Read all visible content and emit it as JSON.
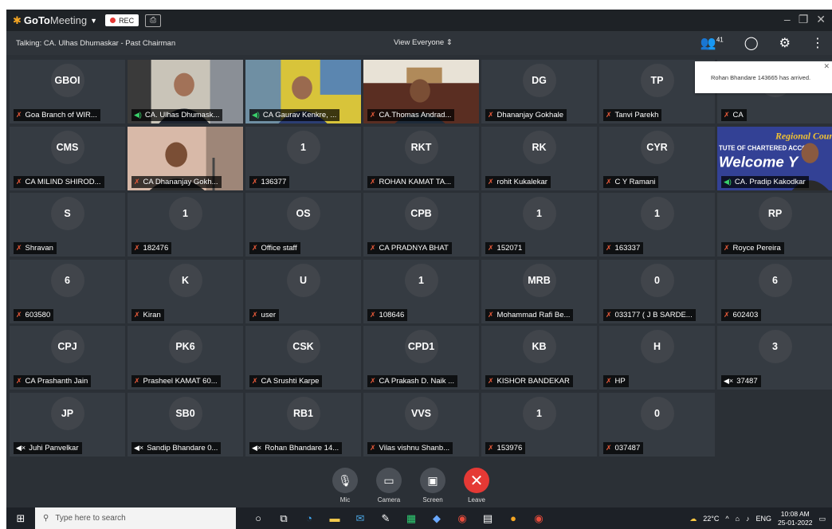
{
  "app": {
    "brand_go": "GoTo",
    "brand_meeting": "Meeting",
    "rec_label": "REC"
  },
  "subbar": {
    "talking": "Talking: CA. Ulhas Dhumaskar - Past Chairman",
    "view": "View Everyone",
    "attendee_count": "41"
  },
  "toast": {
    "message": "Rohan Bhandare 143665 has arrived."
  },
  "tiles": [
    {
      "initials": "GBOI",
      "label": "Goa Branch of WIR...",
      "icon": "muted"
    },
    {
      "initials": "",
      "label": "CA. Ulhas Dhumask...",
      "icon": "talk",
      "video": "v1"
    },
    {
      "initials": "",
      "label": "CA Gaurav Kenkre, ...",
      "icon": "talk",
      "video": "v2"
    },
    {
      "initials": "",
      "label": "CA.Thomas Andrad...",
      "icon": "muted",
      "video": "v3"
    },
    {
      "initials": "DG",
      "label": "Dhananjay Gokhale",
      "icon": "muted"
    },
    {
      "initials": "TP",
      "label": "Tanvi Parekh",
      "icon": "muted"
    },
    {
      "initials": "C",
      "label": "CA",
      "icon": "muted"
    },
    {
      "initials": "CMS",
      "label": "CA MILIND SHIROD...",
      "icon": "muted"
    },
    {
      "initials": "",
      "label": "CA Dhananjay Gokh...",
      "icon": "muted",
      "video": "v4"
    },
    {
      "initials": "1",
      "label": "136377",
      "icon": "muted"
    },
    {
      "initials": "RKT",
      "label": "ROHAN KAMAT TA...",
      "icon": "muted"
    },
    {
      "initials": "RK",
      "label": "rohit Kukalekar",
      "icon": "muted"
    },
    {
      "initials": "CYR",
      "label": "C Y Ramani",
      "icon": "muted"
    },
    {
      "initials": "",
      "label": "CA. Pradip Kakodkar",
      "icon": "talk",
      "video": "v5"
    },
    {
      "initials": "S",
      "label": "Shravan",
      "icon": "muted"
    },
    {
      "initials": "1",
      "label": "182476",
      "icon": "muted"
    },
    {
      "initials": "OS",
      "label": "Office staff",
      "icon": "muted"
    },
    {
      "initials": "CPB",
      "label": "CA PRADNYA BHAT",
      "icon": "muted"
    },
    {
      "initials": "1",
      "label": "152071",
      "icon": "muted"
    },
    {
      "initials": "1",
      "label": "163337",
      "icon": "muted"
    },
    {
      "initials": "RP",
      "label": "Royce Pereira",
      "icon": "muted"
    },
    {
      "initials": "6",
      "label": "603580",
      "icon": "muted"
    },
    {
      "initials": "K",
      "label": "Kiran",
      "icon": "muted"
    },
    {
      "initials": "U",
      "label": "user",
      "icon": "muted"
    },
    {
      "initials": "1",
      "label": "108646",
      "icon": "muted"
    },
    {
      "initials": "MRB",
      "label": "Mohammad Rafi Be...",
      "icon": "muted"
    },
    {
      "initials": "0",
      "label": "033177 ( J B SARDE...",
      "icon": "muted"
    },
    {
      "initials": "6",
      "label": "602403",
      "icon": "muted"
    },
    {
      "initials": "CPJ",
      "label": "CA Prashanth Jain",
      "icon": "muted"
    },
    {
      "initials": "PK6",
      "label": "Prasheel KAMAT 60...",
      "icon": "muted"
    },
    {
      "initials": "CSK",
      "label": "CA Srushti Karpe",
      "icon": "muted"
    },
    {
      "initials": "CPD1",
      "label": "CA Prakash D. Naik ...",
      "icon": "muted"
    },
    {
      "initials": "KB",
      "label": "KISHOR BANDEKAR",
      "icon": "muted"
    },
    {
      "initials": "H",
      "label": "HP",
      "icon": "muted"
    },
    {
      "initials": "3",
      "label": "37487",
      "icon": "speaker"
    },
    {
      "initials": "JP",
      "label": "Juhi Panvelkar",
      "icon": "speaker"
    },
    {
      "initials": "SB0",
      "label": "Sandip Bhandare 0...",
      "icon": "speaker"
    },
    {
      "initials": "RB1",
      "label": "Rohan Bhandare 14...",
      "icon": "speaker"
    },
    {
      "initials": "VVS",
      "label": "Vilas vishnu Shanb...",
      "icon": "muted"
    },
    {
      "initials": "1",
      "label": "153976",
      "icon": "muted"
    },
    {
      "initials": "0",
      "label": "037487",
      "icon": "muted"
    }
  ],
  "banner": {
    "line1": "Regional Council of",
    "line2": "TUTE OF CHARTERED ACCOUN",
    "line3": "Welcome Y"
  },
  "controls": {
    "mic": "Mic",
    "camera": "Camera",
    "screen": "Screen",
    "leave": "Leave"
  },
  "taskbar": {
    "search_placeholder": "Type here to search",
    "weather": "22°C",
    "lang": "ENG",
    "time": "10:08 AM",
    "date": "25-01-2022"
  }
}
